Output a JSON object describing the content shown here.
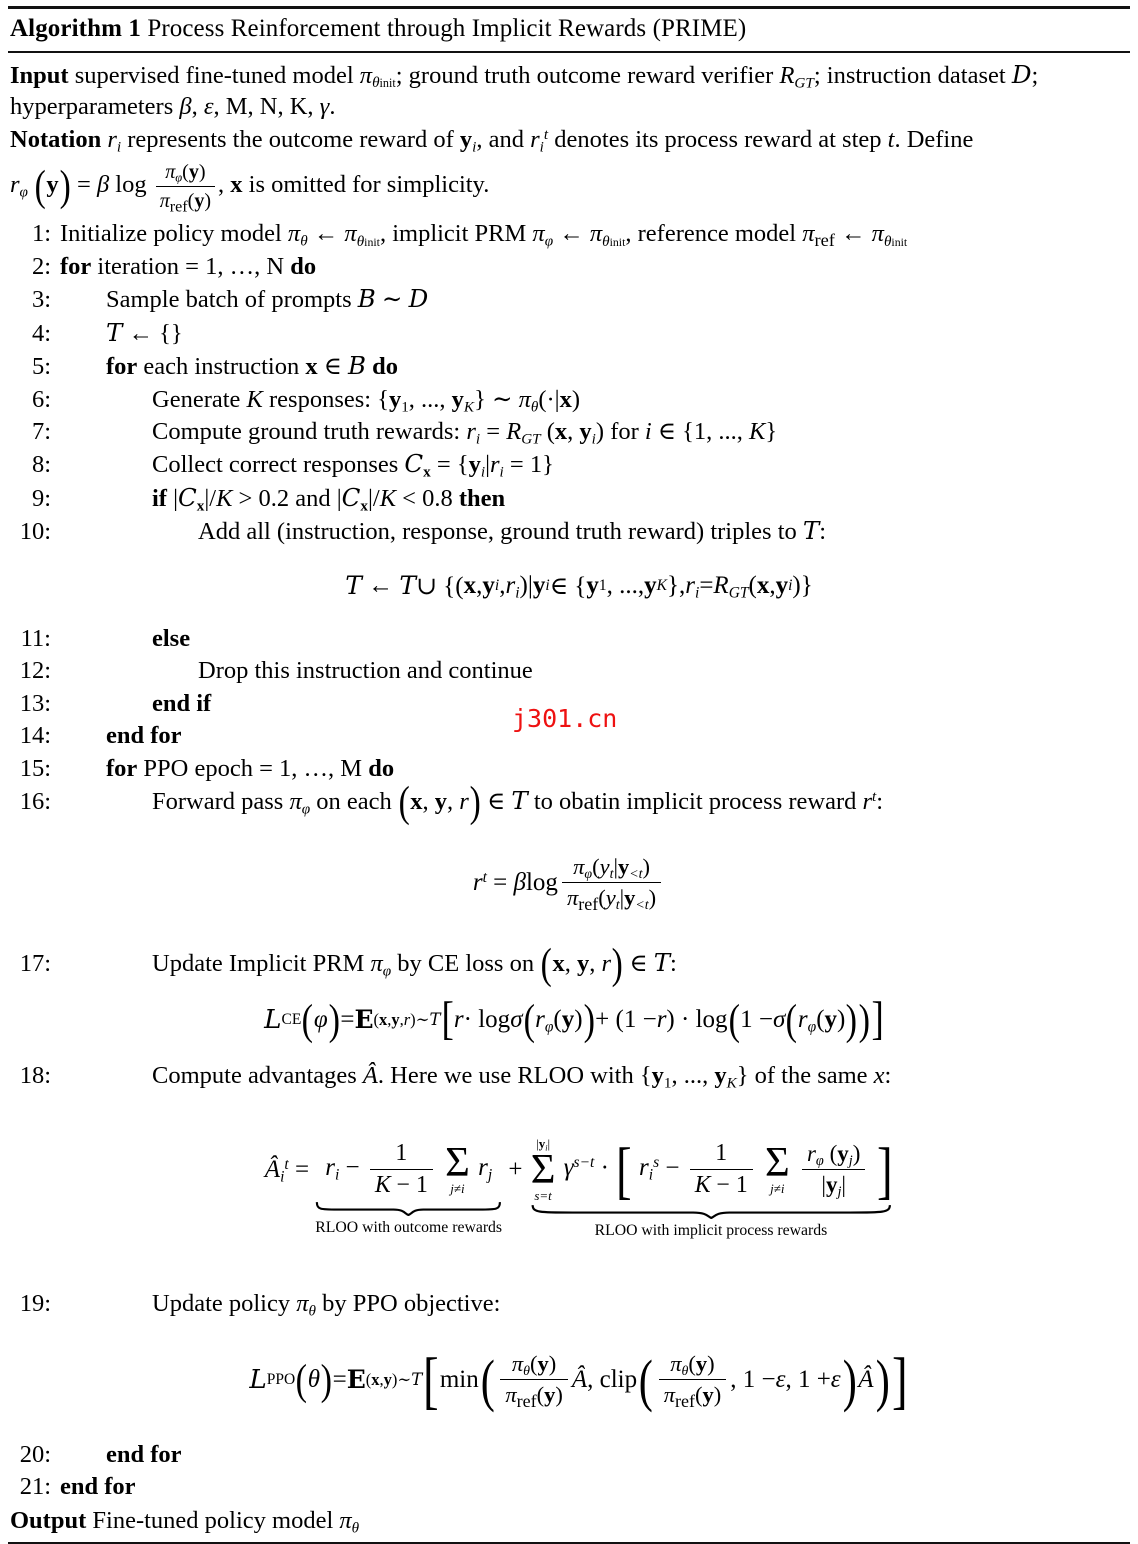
{
  "algorithm": {
    "label": "Algorithm 1",
    "title": "Process Reinforcement through Implicit Rewards (PRIME)",
    "preamble": {
      "input_kw": "Input",
      "input_text_a": "supervised fine-tuned model",
      "input_pi_init": "πθinit",
      "input_text_b": "; ground truth outcome reward verifier",
      "input_rgt": "RGT",
      "input_text_c": "; instruction dataset",
      "input_dataset": "D",
      "input_text_d": "; hyperparameters",
      "input_hyper": "β, ϵ, M, N, K, γ.",
      "notation_kw": "Notation",
      "notation_text_a": "ri",
      "notation_text_b": "represents the outcome reward of",
      "notation_yi": "yi",
      "notation_text_c": ", and",
      "notation_rit": "rit",
      "notation_text_d": "denotes its process reward at step",
      "notation_t": "t",
      "notation_text_e": ". Define",
      "notation_def_text": ", x is omitted for simplicity."
    },
    "lines": [
      {
        "num": "1:",
        "indent": 0,
        "text": "Initialize policy model πθ ← πθinit, implicit PRM πφ ← πθinit, reference model πref ← πθinit"
      },
      {
        "num": "2:",
        "indent": 0,
        "text": "for iteration = 1, …, N do"
      },
      {
        "num": "3:",
        "indent": 1,
        "text": "Sample batch of prompts B ∼ D"
      },
      {
        "num": "4:",
        "indent": 1,
        "text": "T ← {}"
      },
      {
        "num": "5:",
        "indent": 1,
        "text": "for each instruction x ∈ B do"
      },
      {
        "num": "6:",
        "indent": 2,
        "text": "Generate K responses: {y1, ..., yK} ∼ πθ(·|x)"
      },
      {
        "num": "7:",
        "indent": 2,
        "text": "Compute ground truth rewards: ri = RGT (x, yi) for i ∈ {1, ..., K}"
      },
      {
        "num": "8:",
        "indent": 2,
        "text": "Collect correct responses Cx = {yi|ri = 1}"
      },
      {
        "num": "9:",
        "indent": 2,
        "text": "if |Cx|/K > 0.2 and |Cx|/K < 0.8 then"
      },
      {
        "num": "10:",
        "indent": 3,
        "text": "Add all (instruction, response, ground truth reward) triples to T:"
      },
      {
        "num": "11:",
        "indent": 2,
        "text": "else"
      },
      {
        "num": "12:",
        "indent": 3,
        "text": "Drop this instruction and continue"
      },
      {
        "num": "13:",
        "indent": 2,
        "text": "end if"
      },
      {
        "num": "14:",
        "indent": 1,
        "text": "end for"
      },
      {
        "num": "15:",
        "indent": 1,
        "text": "for PPO epoch = 1, …, M do"
      },
      {
        "num": "16:",
        "indent": 2,
        "text": "Forward pass πφ on each (x, y, r) ∈ T to obatin implicit process reward rt:"
      },
      {
        "num": "17:",
        "indent": 2,
        "text": "Update Implicit PRM πφ by CE loss on (x, y, r) ∈ T:"
      },
      {
        "num": "18:",
        "indent": 2,
        "text": "Compute advantages Â. Here we use RLOO with {y1, ..., yK} of the same x:"
      },
      {
        "num": "19:",
        "indent": 2,
        "text": "Update policy πθ by PPO objective:"
      },
      {
        "num": "20:",
        "indent": 1,
        "text": "end for"
      },
      {
        "num": "21:",
        "indent": 0,
        "text": "end for"
      }
    ],
    "keywords": {
      "for": "for",
      "do": "do",
      "if": "if",
      "then": "then",
      "else": "else",
      "end_if": "end if",
      "end_for": "end for"
    },
    "equations": {
      "eq_line10": "T ← T ∪ {(x, yi, ri)|yi ∈ {y1, ..., yK}, ri = RGT(x, yi)}",
      "eq_line16": "rt = β log πφ(yt|y<t) / πref(yt|y<t)",
      "eq_line17": "LCE(φ) = E(x,y,r)~T [r · log σ (rφ (y)) + (1 − r) · log (1 − σ (rφ (y)))]",
      "eq_line18": "Âit = ri − 1/(K−1) Σj≠i rj + Σs=t^|yi| γ^(s−t) · [ris − 1/(K−1) Σj≠i rφ(yj)/|yj|]",
      "eq_line19": "LPPO(θ) = E(x,y)~T [min(πθ(y)/πref(y) Â, clip(πθ(y)/πref(y), 1−ϵ, 1+ϵ) Â)]",
      "underbrace_left_label": "RLOO with outcome rewards",
      "underbrace_right_label": "RLOO with implicit process rewards"
    },
    "output": {
      "kw": "Output",
      "text": "Fine-tuned policy model",
      "symbol": "πθ"
    }
  },
  "watermark": {
    "text": "j301.cn",
    "color": "#ee1111"
  }
}
